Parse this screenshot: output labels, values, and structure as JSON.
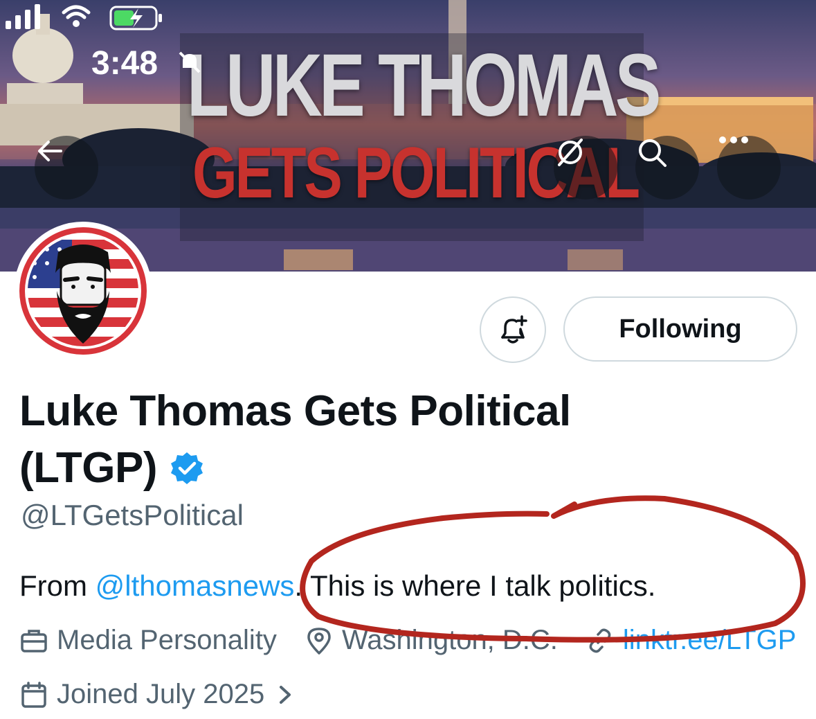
{
  "status_bar": {
    "time": "3:48"
  },
  "banner": {
    "title_line_1": "LUKE THOMAS",
    "title_line_2": "GETS POLITICAL"
  },
  "buttons": {
    "following_label": "Following"
  },
  "profile": {
    "name_line_1": "Luke Thomas Gets Political",
    "name_line_2": "(LTGP)",
    "handle": "@LTGetsPolitical",
    "bio_prefix": "From ",
    "bio_mention": "@lthomasnews",
    "bio_suffix": ". This is where I talk politics.",
    "category": "Media Personality",
    "location": "Washington, D.C.",
    "link": "linktr.ee/LTGP",
    "joined": "Joined July 2025"
  },
  "icons": {
    "back": "arrow-left-icon",
    "grok": "grok-icon",
    "search": "search-icon",
    "more": "more-icon",
    "notify": "bell-plus-icon",
    "verified": "verified-badge-icon",
    "category": "briefcase-icon",
    "location": "location-pin-icon",
    "link": "link-icon",
    "joined": "calendar-icon",
    "chevron": "chevron-right-icon"
  },
  "colors": {
    "accent": "#1d9bf0",
    "text": "#0f1419",
    "secondary_text": "#536471",
    "border": "#cfd9de",
    "annotation": "#b3261e",
    "banner_red": "#c7322e"
  }
}
